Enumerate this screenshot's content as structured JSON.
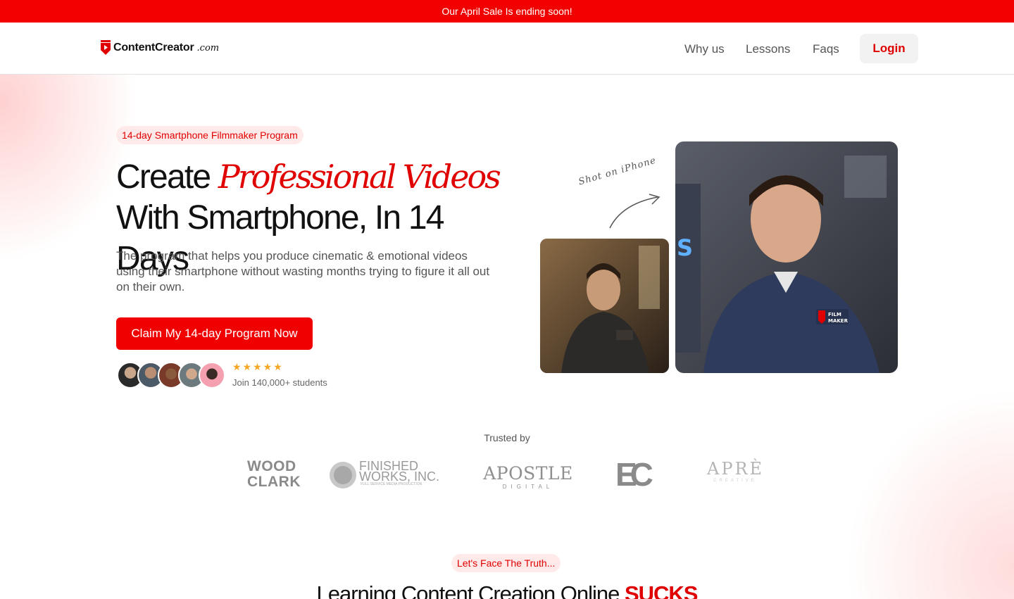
{
  "banner": {
    "text": "Our April Sale Is ending soon!"
  },
  "nav": {
    "logo_text": "ContentCreator",
    "logo_tld": ".com",
    "links": [
      "Why us",
      "Lessons",
      "Faqs"
    ],
    "login": "Login"
  },
  "hero": {
    "pill": "14-day Smartphone Filmmaker Program",
    "headline_pre": "Create ",
    "headline_accent": "Professional Videos",
    "headline_post": " With Smartphone, In 14 Days",
    "subtext": "The program that helps you produce cinematic & emotional videos using  their smartphone without wasting months trying to figure it all out  on their own.",
    "cta": "Claim My 14-day Program Now",
    "stars": "★★★★★",
    "students": "Join 140,000+ students",
    "shot_on": "Shot on iPhone"
  },
  "trusted": {
    "label": "Trusted by",
    "brands": {
      "wood_clark_1": "WOOD",
      "wood_clark_2": "CLARK",
      "finished_1": "FINISHED",
      "finished_2": "WORKS, INC.",
      "finished_3": "FULL SERVICE MEDIA PRODUCTION",
      "apostle": "APOSTLE",
      "apostle_sub": "DIGITAL",
      "ec": "EC",
      "apre": "APRÈ",
      "apre_sub": "CREATIVE"
    }
  },
  "truth": {
    "pill": "Let's Face The Truth...",
    "title": "Learning Content Creation Online ",
    "title_accent": "SUCKS"
  },
  "colors": {
    "brand_red": "#f20000",
    "star": "#f5a623"
  }
}
